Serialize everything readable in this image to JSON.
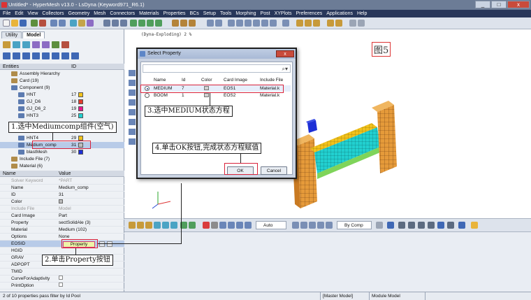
{
  "window": {
    "title": "Untitled* - HyperMesh v13.0 - LsDyna (Keyword971_R6.1)",
    "controls": [
      "_",
      "□",
      "x"
    ]
  },
  "menu": [
    "File",
    "Edit",
    "View",
    "Collectors",
    "Geometry",
    "Mesh",
    "Connectors",
    "Materials",
    "Properties",
    "BCs",
    "Setup",
    "Tools",
    "Morphing",
    "Post",
    "XYPlots",
    "Preferences",
    "Applications",
    "Help"
  ],
  "left_tabs": [
    "Utility",
    "Model"
  ],
  "entities": {
    "header_name": "Entities",
    "header_id": "ID",
    "rows": [
      {
        "name": "Assembly Hierarchy",
        "id": ""
      },
      {
        "name": "Card (19)",
        "id": ""
      },
      {
        "name": "Component (9)",
        "id": ""
      },
      {
        "name": "HNT",
        "id": "17",
        "color": "#f2c21b"
      },
      {
        "name": "GJ_D6",
        "id": "18",
        "color": "#e33b2d"
      },
      {
        "name": "GJ_D6_2",
        "id": "19",
        "color": "#e8188a"
      },
      {
        "name": "HNT3",
        "id": "25",
        "color": "#22d0d0"
      },
      {
        "name": "HNT4",
        "id": "29",
        "color": "#f2c21b"
      },
      {
        "name": "Medium_comp",
        "id": "31",
        "color": "#bdbdbd"
      },
      {
        "name": "blastMesh",
        "id": "30",
        "color": "#1d2fd6"
      },
      {
        "name": "Include File (7)",
        "id": ""
      },
      {
        "name": "Material (6)",
        "id": ""
      }
    ]
  },
  "properties": {
    "header_name": "Name",
    "header_value": "Value",
    "rows": [
      {
        "name": "Solver Keyword",
        "value": "*PART",
        "dim": true
      },
      {
        "name": "Name",
        "value": "Medium_comp"
      },
      {
        "name": "ID",
        "value": "31"
      },
      {
        "name": "Color",
        "value": ""
      },
      {
        "name": "Include File",
        "value": "Model",
        "dim": true
      },
      {
        "name": "Card Image",
        "value": "Part"
      },
      {
        "name": "Property",
        "value": "sectSolidAle (3)"
      },
      {
        "name": "Material",
        "value": "Medium (102)"
      },
      {
        "name": "Options",
        "value": "None"
      },
      {
        "name": "EOSID",
        "value": ""
      },
      {
        "name": "HGID",
        "value": ""
      },
      {
        "name": "GRAV",
        "value": ""
      },
      {
        "name": "ADPOPT",
        "value": ""
      },
      {
        "name": "TMID",
        "value": ""
      },
      {
        "name": "CurveForAdaptivity",
        "value": ""
      },
      {
        "name": "PrintOption",
        "value": ""
      }
    ],
    "property_button": "Property"
  },
  "command_line": "(Dyna-Exploding) 2 %",
  "figure_label": "图5",
  "dialog": {
    "title": "Select Property",
    "close": "x",
    "columns": [
      "Name",
      "Id",
      "Color",
      "Card Image",
      "Include File"
    ],
    "rows": [
      {
        "name": "MEDIUM",
        "id": "7",
        "card": "EOS1",
        "file": "Material.k"
      },
      {
        "name": "BOOM",
        "id": "1",
        "card": "EOS2",
        "file": "Material.k"
      }
    ],
    "ok": "OK",
    "cancel": "Cancel"
  },
  "graphics_toolbar": {
    "view_select": "Auto",
    "color_mode": "By Comp"
  },
  "status": {
    "left": "2 of 10 properties pass filter by Id Pool",
    "model1": "Master Model",
    "model2": "Module Model"
  },
  "annotations": {
    "step1": "1.选中Mediumcomp组件(空气)",
    "step2": "2.单击Property按钮",
    "step3": "3.选中MEDIUM状态方程",
    "step4": "4.单击OK按钮,完成状态方程赋值"
  }
}
